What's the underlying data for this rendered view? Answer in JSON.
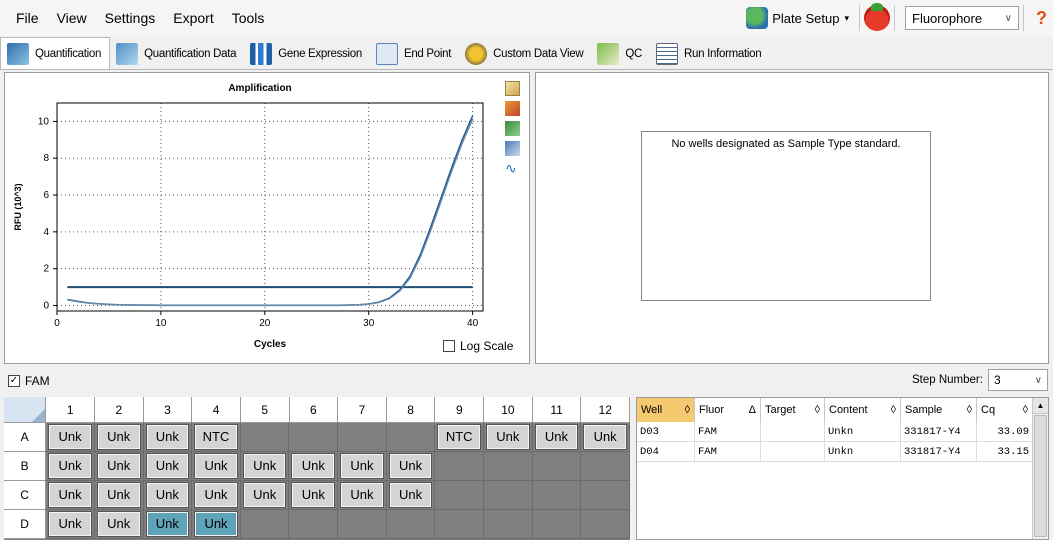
{
  "menu": [
    "File",
    "View",
    "Settings",
    "Export",
    "Tools"
  ],
  "toolbar": {
    "plate_setup": "Plate Setup",
    "fluorophore": "Fluorophore",
    "help": "?"
  },
  "tabs": [
    {
      "label": "Quantification",
      "active": true,
      "icon": "amplification-chart-icon"
    },
    {
      "label": "Quantification Data",
      "active": false,
      "icon": "quant-data-icon"
    },
    {
      "label": "Gene Expression",
      "active": false,
      "icon": "bar-chart-icon"
    },
    {
      "label": "End Point",
      "active": false,
      "icon": "end-point-icon"
    },
    {
      "label": "Custom Data View",
      "active": false,
      "icon": "custom-view-icon"
    },
    {
      "label": "QC",
      "active": false,
      "icon": "qc-icon"
    },
    {
      "label": "Run Information",
      "active": false,
      "icon": "run-info-icon"
    }
  ],
  "chart_data": {
    "type": "line",
    "title": "Amplification",
    "xlabel": "Cycles",
    "ylabel": "RFU (10^3)",
    "xlim": [
      0,
      41
    ],
    "ylim": [
      -0.3,
      11
    ],
    "xticks": [
      0,
      10,
      20,
      30,
      40
    ],
    "yticks": [
      0,
      2,
      4,
      6,
      8,
      10
    ],
    "grid": "dotted",
    "threshold": 1.0,
    "series": [
      {
        "x": [
          1,
          2,
          3,
          4,
          5,
          6,
          7,
          8,
          9,
          10,
          11,
          12,
          13,
          14,
          15,
          16,
          17,
          18,
          19,
          20,
          21,
          22,
          23,
          24,
          25,
          26,
          27,
          28,
          29,
          30,
          31,
          32,
          33,
          34,
          35,
          36,
          37,
          38,
          39,
          40
        ],
        "values": [
          0.32,
          0.22,
          0.14,
          0.09,
          0.06,
          0.04,
          0.03,
          0.02,
          0.02,
          0.01,
          0.01,
          0.01,
          0.01,
          0.01,
          0.01,
          0.01,
          0.01,
          0.01,
          0.01,
          0.01,
          0.01,
          0.01,
          0.01,
          0.01,
          0.01,
          0.01,
          0.01,
          0.02,
          0.04,
          0.08,
          0.18,
          0.4,
          0.85,
          1.6,
          2.8,
          4.3,
          5.9,
          7.5,
          9.0,
          10.3
        ],
        "color": "#2f5c8a"
      },
      {
        "x": [
          1,
          2,
          3,
          4,
          5,
          6,
          7,
          8,
          9,
          10,
          11,
          12,
          13,
          14,
          15,
          16,
          17,
          18,
          19,
          20,
          21,
          22,
          23,
          24,
          25,
          26,
          27,
          28,
          29,
          30,
          31,
          32,
          33,
          34,
          35,
          36,
          37,
          38,
          39,
          40
        ],
        "values": [
          0.3,
          0.2,
          0.13,
          0.08,
          0.05,
          0.04,
          0.03,
          0.02,
          0.02,
          0.01,
          0.01,
          0.01,
          0.01,
          0.01,
          0.01,
          0.01,
          0.01,
          0.01,
          0.01,
          0.01,
          0.01,
          0.01,
          0.01,
          0.01,
          0.01,
          0.01,
          0.01,
          0.02,
          0.04,
          0.07,
          0.16,
          0.36,
          0.78,
          1.5,
          2.65,
          4.1,
          5.7,
          7.3,
          8.8,
          10.1
        ],
        "color": "#6a8fb5"
      }
    ]
  },
  "log_scale": {
    "label": "Log Scale",
    "checked": false
  },
  "standard_message": "No wells designated as Sample Type standard.",
  "fam": {
    "label": "FAM",
    "checked": true
  },
  "step": {
    "label": "Step Number:",
    "value": "3"
  },
  "plate": {
    "columns": [
      "1",
      "2",
      "3",
      "4",
      "5",
      "6",
      "7",
      "8",
      "9",
      "10",
      "11",
      "12"
    ],
    "rows": [
      {
        "label": "A",
        "cells": [
          "Unk",
          "Unk",
          "Unk",
          "NTC",
          "",
          "",
          "",
          "",
          "NTC",
          "Unk",
          "Unk",
          "Unk"
        ]
      },
      {
        "label": "B",
        "cells": [
          "Unk",
          "Unk",
          "Unk",
          "Unk",
          "Unk",
          "Unk",
          "Unk",
          "Unk",
          "",
          "",
          "",
          ""
        ]
      },
      {
        "label": "C",
        "cells": [
          "Unk",
          "Unk",
          "Unk",
          "Unk",
          "Unk",
          "Unk",
          "Unk",
          "Unk",
          "",
          "",
          "",
          ""
        ]
      },
      {
        "label": "D",
        "cells": [
          "Unk",
          "Unk",
          "Unk",
          "Unk",
          "",
          "",
          "",
          "",
          "",
          "",
          "",
          ""
        ],
        "selected": [
          2,
          3
        ]
      }
    ]
  },
  "wells_table": {
    "headers": [
      "Well",
      "Fluor",
      "Target",
      "Content",
      "Sample",
      "Cq"
    ],
    "sort_icons": [
      "◊",
      "Δ",
      "◊",
      "◊",
      "◊",
      "◊"
    ],
    "rows": [
      [
        "D03",
        "FAM",
        "",
        "Unkn",
        "331817-Y4",
        "33.09"
      ],
      [
        "D04",
        "FAM",
        "",
        "Unkn",
        "331817-Y4",
        "33.15"
      ]
    ]
  }
}
